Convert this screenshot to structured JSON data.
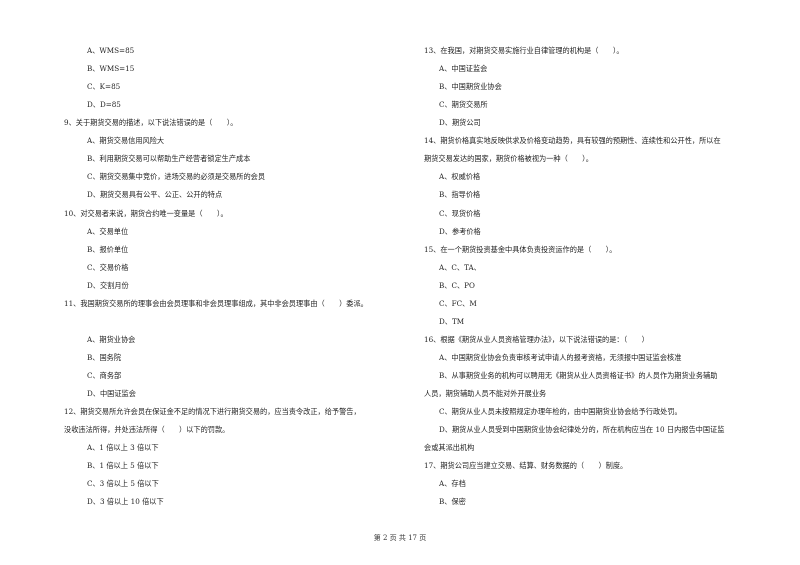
{
  "page": {
    "footer": "第 2 页 共 17 页"
  },
  "left": {
    "q8_options": [
      "A、WMS=85",
      "B、WMS=15",
      "C、K=85",
      "D、D=85"
    ],
    "q9": {
      "stem": "9、关于期货交易的描述，以下说法错误的是（　　）。",
      "options": [
        "A、期货交易信用风险大",
        "B、利用期货交易可以帮助生产经营者锁定生产成本",
        "C、期货交易集中竞价，进场交易的必须是交易所的会员",
        "D、期货交易具有公平、公正、公开的特点"
      ]
    },
    "q10": {
      "stem": "10、对交易者来说，期货合约唯一变量是（　　）。",
      "options": [
        "A、交易单位",
        "B、报价单位",
        "C、交易价格",
        "D、交割月份"
      ]
    },
    "q11": {
      "stem": "11、我国期货交易所的理事会由会员理事和非会员理事组成，其中非会员理事由（　　）委派。",
      "options": [
        "A、期货业协会",
        "B、国务院",
        "C、商务部",
        "D、中国证监会"
      ]
    },
    "q12": {
      "stem_line1": "12、期货交易所允许会员在保证金不足的情况下进行期货交易的，应当责令改正，给予警告，",
      "stem_line2": "没收违法所得，并处违法所得（　　）以下的罚款。",
      "options": [
        "A、1 倍以上 3 倍以下",
        "B、1 倍以上 5 倍以下",
        "C、3 倍以上 5 倍以下",
        "D、3 倍以上 10 倍以下"
      ]
    }
  },
  "right": {
    "q13": {
      "stem": "13、在我国，对期货交易实施行业自律管理的机构是（　　）。",
      "options": [
        "A、中国证监会",
        "B、中国期货业协会",
        "C、期货交易所",
        "D、期货公司"
      ]
    },
    "q14": {
      "stem_line1": "14、期货价格真实地反映供求及价格变动趋势，具有较强的预期性、连续性和公开性，所以在",
      "stem_line2": "期货交易发达的国家，期货价格被视为一种（　　）。",
      "options": [
        "A、权威价格",
        "B、指导价格",
        "C、现货价格",
        "D、参考价格"
      ]
    },
    "q15": {
      "stem": "15、在一个期货投资基金中具体负责投资运作的是（　　）。",
      "options": [
        "A、C、TA、",
        "B、C、PO",
        "C、FC、M",
        "D、TM"
      ]
    },
    "q16": {
      "stem": "16、根据《期货从业人员资格管理办法》，以下说法错误的是：（　　）",
      "option_a": "A、中国期货业协会负责审核考试申请人的报考资格，无须报中国证监会核准",
      "option_b_line1": "B、从事期货业务的机构可以聘用无《期货从业人员资格证书》的人员作为期货业务辅助",
      "option_b_line2": "人员，期货辅助人员不能对外开展业务",
      "option_c": "C、期货从业人员未按照规定办理年检的，由中国期货业协会给予行政处罚。",
      "option_d_line1": "D、期货从业人员受到中国期货业协会纪律处分的，所在机构应当在 10 日内报告中国证监",
      "option_d_line2": "会或其派出机构"
    },
    "q17": {
      "stem": "17、期货公司应当建立交易、结算、财务数据的（　　）制度。",
      "options": [
        "A、存档",
        "B、保密"
      ]
    }
  }
}
